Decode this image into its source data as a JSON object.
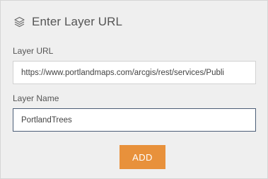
{
  "header": {
    "icon": "layers-icon",
    "title": "Enter Layer URL"
  },
  "form": {
    "url_label": "Layer URL",
    "url_value": "https://www.portlandmaps.com/arcgis/rest/services/Publi",
    "name_label": "Layer Name",
    "name_value": "PortlandTrees",
    "add_label": "ADD"
  },
  "colors": {
    "panel_bg": "#efefef",
    "accent": "#e8913b",
    "focus_border": "#4c5e77",
    "text": "#555555"
  }
}
